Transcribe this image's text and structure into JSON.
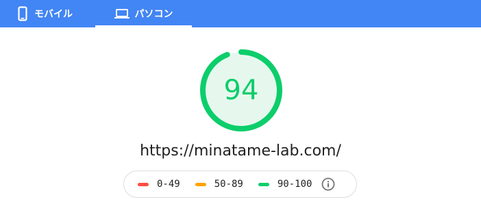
{
  "tabs": {
    "mobile": {
      "label": "モバイル",
      "icon": "smartphone-icon"
    },
    "desktop": {
      "label": "パソコン",
      "icon": "laptop-icon",
      "selected": true
    }
  },
  "report": {
    "score": "94",
    "score_fraction": 0.94,
    "url": "https://minatame-lab.com/"
  },
  "legend": {
    "items": [
      {
        "label": "0-49",
        "color": "#ff4e42"
      },
      {
        "label": "50-89",
        "color": "#ffa400"
      },
      {
        "label": "90-100",
        "color": "#0cce6b"
      }
    ],
    "info_icon": "info-icon"
  },
  "colors": {
    "tab_bar": "#4285f4",
    "pass": "#0cce6b",
    "pass_fill": "#e6f8ee"
  }
}
